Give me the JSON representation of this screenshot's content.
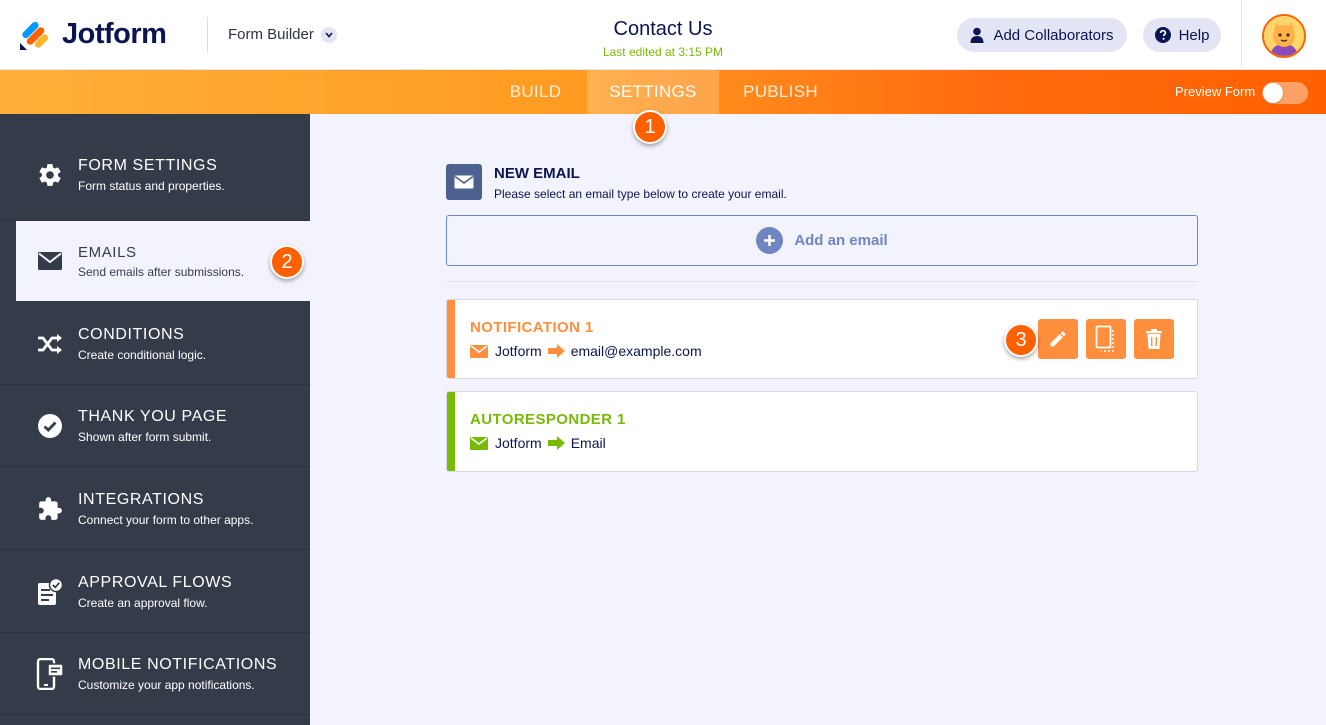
{
  "header": {
    "logo_text": "Jotform",
    "builder_label": "Form Builder",
    "form_title": "Contact Us",
    "last_edited": "Last edited at 3:15 PM",
    "collaborators_label": "Add Collaborators",
    "help_label": "Help"
  },
  "tabs": [
    {
      "label": "BUILD"
    },
    {
      "label": "SETTINGS",
      "active": true
    },
    {
      "label": "PUBLISH"
    }
  ],
  "preview_label": "Preview Form",
  "preview_enabled": false,
  "badges": [
    "1",
    "2",
    "3"
  ],
  "sidebar": {
    "items": [
      {
        "title": "FORM SETTINGS",
        "desc": "Form status and properties.",
        "icon": "gear-icon"
      },
      {
        "title": "EMAILS",
        "desc": "Send emails after submissions.",
        "icon": "envelope-icon",
        "active": true
      },
      {
        "title": "CONDITIONS",
        "desc": "Create conditional logic.",
        "icon": "shuffle-icon"
      },
      {
        "title": "THANK YOU PAGE",
        "desc": "Shown after form submit.",
        "icon": "check-circle-icon"
      },
      {
        "title": "INTEGRATIONS",
        "desc": "Connect your form to other apps.",
        "icon": "puzzle-icon"
      },
      {
        "title": "APPROVAL FLOWS",
        "desc": "Create an approval flow.",
        "icon": "approval-doc-icon"
      },
      {
        "title": "MOBILE NOTIFICATIONS",
        "desc": "Customize your app notifications.",
        "icon": "mobile-notification-icon"
      }
    ]
  },
  "main": {
    "new_email_title": "NEW EMAIL",
    "new_email_sub": "Please select an email type below to create your email.",
    "add_email_label": "Add an email",
    "emails": [
      {
        "title": "NOTIFICATION 1",
        "from": "Jotform",
        "to": "email@example.com",
        "color": "#ff8f3d"
      },
      {
        "title": "AUTORESPONDER 1",
        "from": "Jotform",
        "to": "Email",
        "color": "#78bb07"
      }
    ]
  },
  "colors": {
    "accent_orange": "#ff6100",
    "sidebar_bg": "#343c4a",
    "notification": "#ff8f3d",
    "autoresponder": "#78bb07",
    "add_email_blue": "#6f86c3"
  }
}
